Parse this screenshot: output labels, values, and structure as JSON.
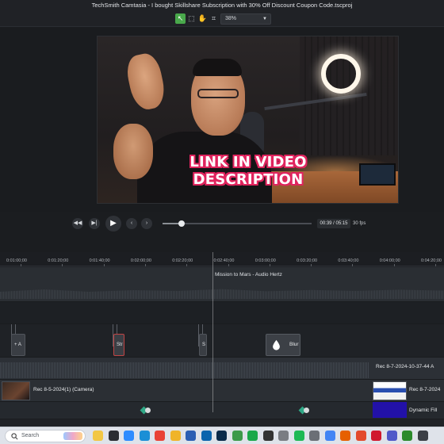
{
  "app": {
    "title": "TechSmith Camtasia - I bought Skillshare Subscription with 30% Off Discount Coupon Code.tscproj"
  },
  "toolbar": {
    "tools": [
      {
        "name": "select-tool",
        "glyph": "↖",
        "active": true
      },
      {
        "name": "pan-tool",
        "glyph": "⬚",
        "active": false
      },
      {
        "name": "hand-tool",
        "glyph": "✋",
        "active": false
      },
      {
        "name": "crop-tool",
        "glyph": "⌗",
        "active": false
      }
    ],
    "zoom": "38%"
  },
  "canvas": {
    "caption_line1": "LINK IN VIDEO",
    "caption_line2": "DESCRIPTION"
  },
  "playback": {
    "current_time": "00:39",
    "total_time": "05:15",
    "time_display": "00:39 / 05:15",
    "fps": "30 fps",
    "progress_fraction": 0.13
  },
  "timeline": {
    "ruler_ticks": [
      "0:01:00;00",
      "0:01:20;00",
      "0:01:40;00",
      "0:02:00;00",
      "0:02:20;00",
      "0:02:40;00",
      "0:03:00;00",
      "0:03:20;00",
      "0:03:40;00",
      "0:04:00;00",
      "0:04:20;00"
    ],
    "audio_clip": "Mission to Mars - Audio Hertz",
    "effect_clips": [
      {
        "label": "+ A"
      },
      {
        "label": "Str"
      },
      {
        "label": "S"
      }
    ],
    "blur_clip": "Blur",
    "rec_clip_a": "Rec 8-7-2024-10-37-44 A",
    "rec_clip_camera": "Rec 8-5-2024(1) (Camera)",
    "rec_clip_c": "Rec 8-7-2024",
    "dynamic_clip": "Dynamic Fill"
  },
  "taskbar": {
    "search_placeholder": "Search",
    "apps": [
      {
        "name": "file-explorer-icon",
        "color": "#f2c744"
      },
      {
        "name": "store-icon",
        "color": "#2a2d33"
      },
      {
        "name": "zoom-icon",
        "color": "#2d8cff"
      },
      {
        "name": "edge-icon",
        "color": "#1b8fd6"
      },
      {
        "name": "chrome-icon",
        "color": "#e94235"
      },
      {
        "name": "files-icon",
        "color": "#f0b429"
      },
      {
        "name": "word-icon",
        "color": "#2b5fb3"
      },
      {
        "name": "mail-icon",
        "color": "#0a64ad"
      },
      {
        "name": "photoshop-icon",
        "color": "#0a2a4a"
      },
      {
        "name": "camtasia-icon",
        "color": "#3c9a4a"
      },
      {
        "name": "evernote-icon",
        "color": "#1aa84a"
      },
      {
        "name": "notion-icon",
        "color": "#333333"
      },
      {
        "name": "media-icon",
        "color": "#7a7d83"
      },
      {
        "name": "spotify-icon",
        "color": "#1db954"
      },
      {
        "name": "settings-icon",
        "color": "#6b6f76"
      },
      {
        "name": "chrome-icon-2",
        "color": "#4285f4"
      },
      {
        "name": "firefox-icon",
        "color": "#e66000"
      },
      {
        "name": "brave-icon",
        "color": "#e34a2b"
      },
      {
        "name": "opera-icon",
        "color": "#d0182e"
      },
      {
        "name": "teams-icon",
        "color": "#5059c9"
      },
      {
        "name": "xbox-icon",
        "color": "#2b8a2b"
      },
      {
        "name": "terminal-icon",
        "color": "#3b3f46"
      }
    ]
  },
  "colors": {
    "accent": "#49a84b",
    "caption_outline": "#e0245e"
  }
}
